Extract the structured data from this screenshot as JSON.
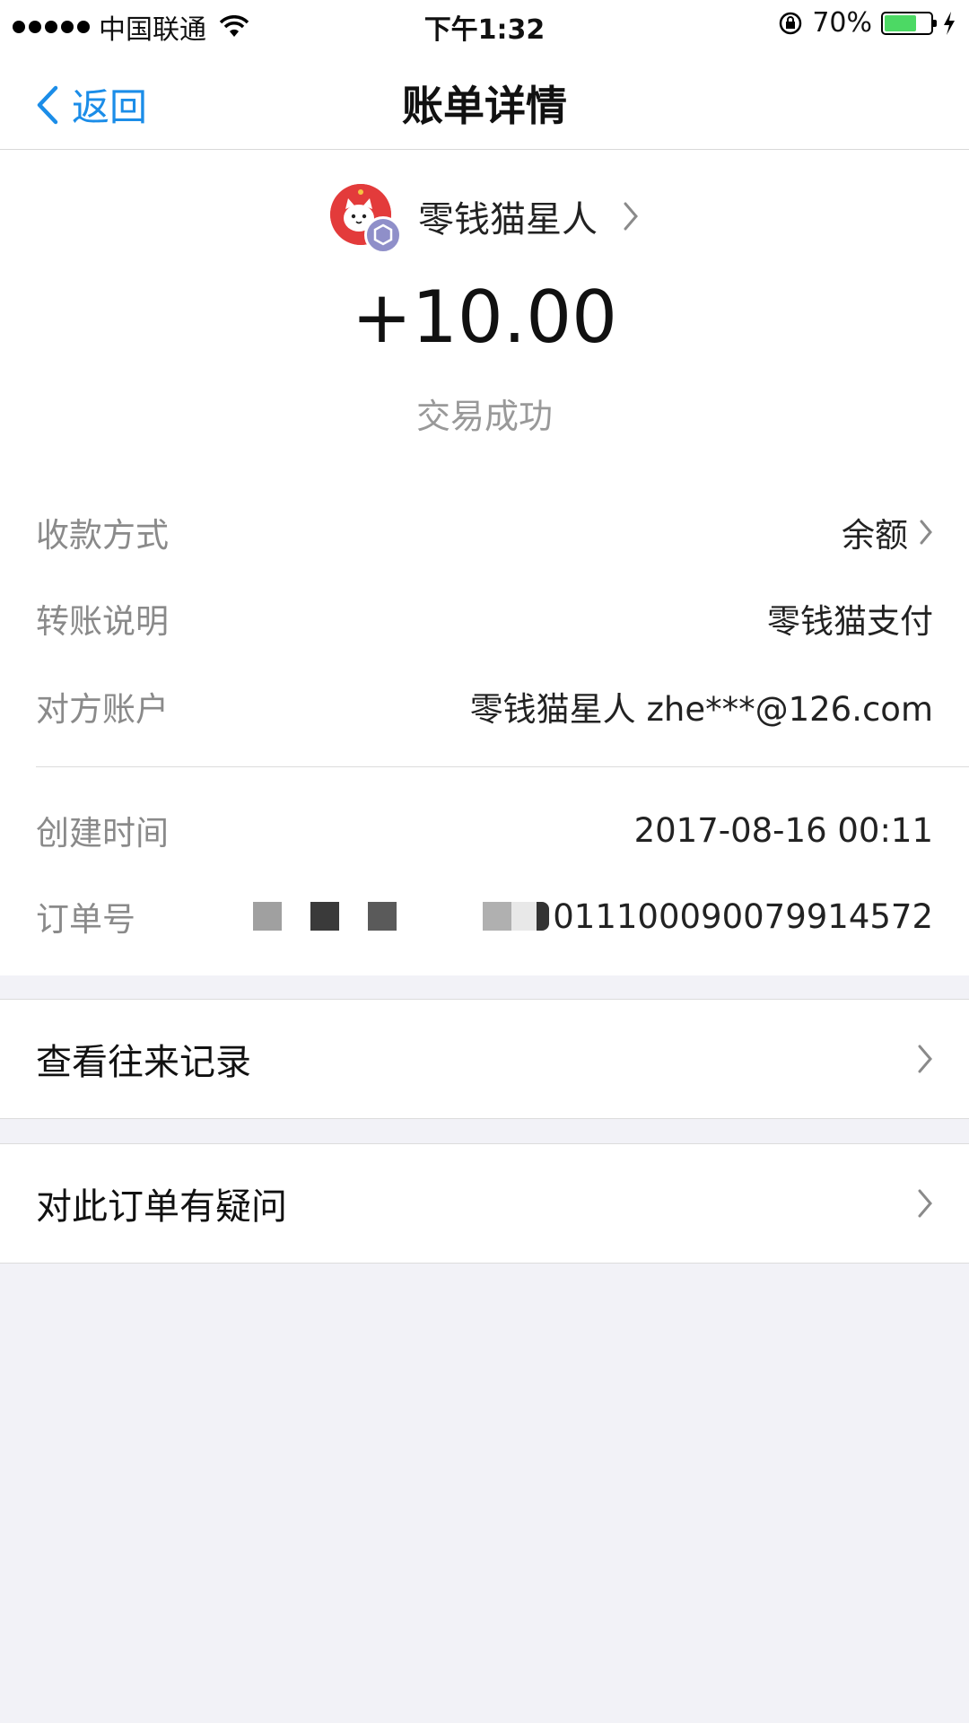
{
  "status_bar": {
    "carrier": "中国联通",
    "time": "下午1:32",
    "battery_percent": "70%",
    "battery_level": 0.7
  },
  "nav": {
    "back_label": "返回",
    "title": "账单详情"
  },
  "merchant": {
    "name": "零钱猫星人"
  },
  "amount": "+10.00",
  "status": "交易成功",
  "details": {
    "payment_method_label": "收款方式",
    "payment_method_value": "余额",
    "note_label": "转账说明",
    "note_value": "零钱猫支付",
    "counterparty_label": "对方账户",
    "counterparty_value": "零钱猫星人 zhe***@126.com",
    "created_label": "创建时间",
    "created_value": "2017-08-16 00:11",
    "order_label": "订单号",
    "order_value": "011100090079914572"
  },
  "actions": {
    "history_label": "查看往来记录",
    "question_label": "对此订单有疑问"
  },
  "colors": {
    "accent": "#1b8de8",
    "battery": "#4cd964",
    "avatar": "#e33b3b"
  }
}
